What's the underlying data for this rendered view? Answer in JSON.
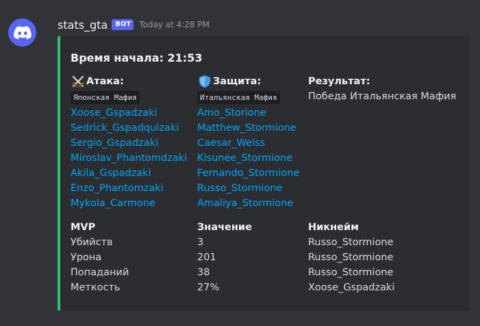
{
  "message": {
    "username": "stats_gta",
    "bot_tag": "BOT",
    "timestamp": "Today at 4:28 PM",
    "accent_color": "#2dc770"
  },
  "embed": {
    "title": "Время начала: 21:53",
    "attack": {
      "icon": "crossed-swords-icon",
      "label": "Атака:",
      "faction": "Японская Мафия",
      "players": [
        "Xoose_Gspadzaki",
        "Sedrick_Gspadquizaki",
        "Sergio_Gspadzaki",
        "Miroslav_Phantomdzaki",
        "Akila_Gspadzaki",
        "Enzo_Phantomzaki",
        "Mykola_Carmone"
      ]
    },
    "defense": {
      "icon": "shield-icon",
      "label": "Защита:",
      "faction": "Итальянская Мафия",
      "players": [
        "Amo_Storione",
        "Matthew_Stormione",
        "Caesar_Weiss",
        "Kisunee_Stormione",
        "Fernando_Stormione",
        "Russo_Stormione",
        "Amaliya_Stormione"
      ]
    },
    "result": {
      "label": "Результат:",
      "value": "Победа Итальянская Мафия"
    },
    "mvp": {
      "headers": [
        "MVP",
        "Значение",
        "Никнейм"
      ],
      "rows": [
        {
          "stat": "Убийств",
          "value": "3",
          "nickname": "Russo_Stormione"
        },
        {
          "stat": "Урона",
          "value": "201",
          "nickname": "Russo_Stormione"
        },
        {
          "stat": "Попаданий",
          "value": "38",
          "nickname": "Russo_Stormione"
        },
        {
          "stat": "Меткость",
          "value": "27%",
          "nickname": "Xoose_Gspadzaki"
        }
      ]
    }
  }
}
